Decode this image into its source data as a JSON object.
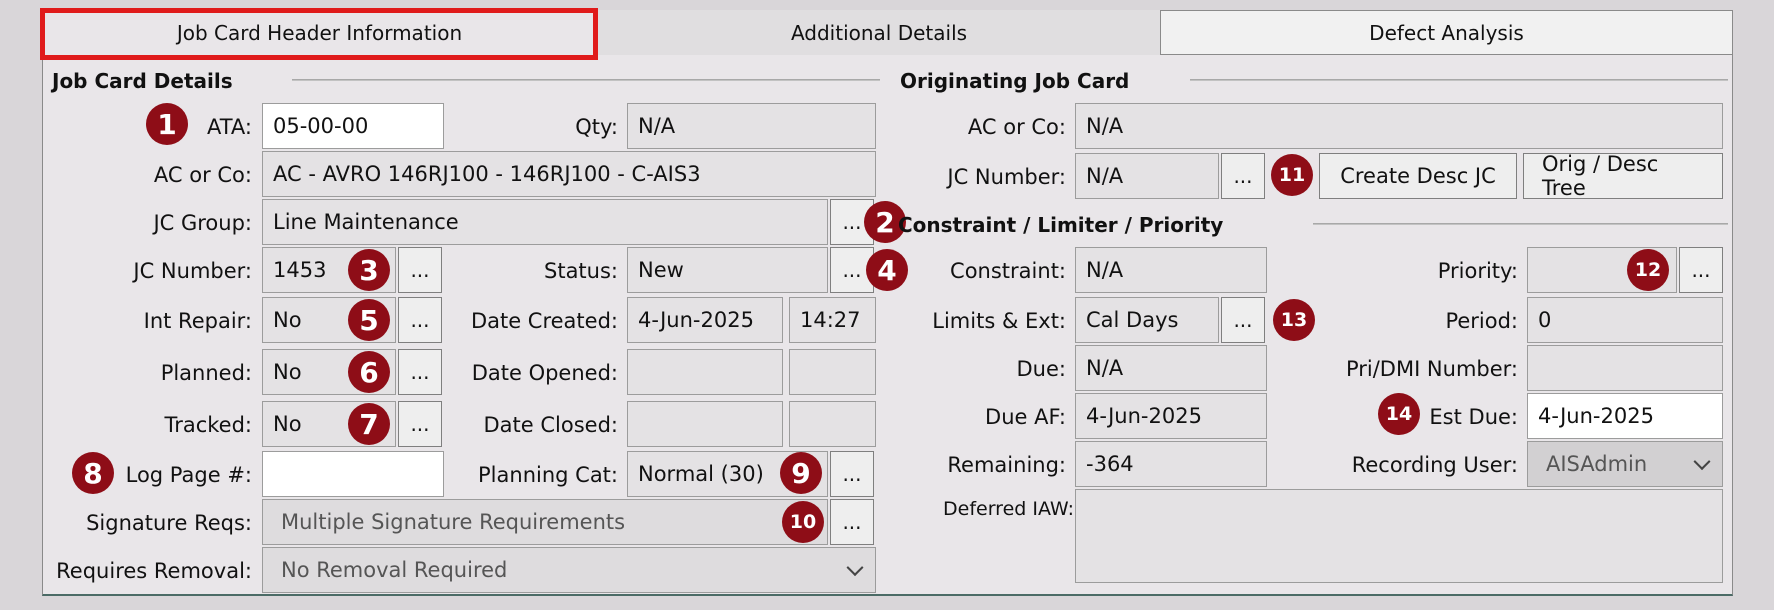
{
  "tabs": [
    {
      "label": "Job Card Header Information"
    },
    {
      "label": "Additional Details"
    },
    {
      "label": "Defect Analysis"
    }
  ],
  "left": {
    "section_title": "Job Card Details",
    "ata_label": "ATA:",
    "ata_value": "05-00-00",
    "qty_label": "Qty:",
    "qty_value": "N/A",
    "ac_label": "AC or Co:",
    "ac_value": "AC - AVRO 146RJ100 - 146RJ100 - C-AIS3",
    "group_label": "JC Group:",
    "group_value": "Line Maintenance",
    "jcnum_label": "JC Number:",
    "jcnum_value": "1453",
    "status_label": "Status:",
    "status_value": "New",
    "intrepair_label": "Int Repair:",
    "intrepair_value": "No",
    "created_label": "Date Created:",
    "created_date": "4-Jun-2025",
    "created_time": "14:27",
    "planned_label": "Planned:",
    "planned_value": "No",
    "opened_label": "Date Opened:",
    "opened_date": "",
    "opened_time": "",
    "tracked_label": "Tracked:",
    "tracked_value": "No",
    "closed_label": "Date Closed:",
    "closed_date": "",
    "closed_time": "",
    "logpage_label": "Log Page #:",
    "logpage_value": "",
    "plancat_label": "Planning Cat:",
    "plancat_value": "Normal (30)",
    "sigreq_label": "Signature Reqs:",
    "sigreq_value": "Multiple Signature Requirements",
    "removal_label": "Requires Removal:",
    "removal_value": "No Removal Required"
  },
  "right": {
    "orig_title": "Originating Job Card",
    "orig_ac_label": "AC or Co:",
    "orig_ac_value": "N/A",
    "orig_jc_label": "JC Number:",
    "orig_jc_value": "N/A",
    "create_desc_label": "Create Desc JC",
    "tree_label": "Orig / Desc Tree",
    "constraint_title": "Constraint / Limiter / Priority",
    "constraint_label": "Constraint:",
    "constraint_value": "N/A",
    "priority_label": "Priority:",
    "priority_value": "",
    "limits_label": "Limits & Ext:",
    "limits_value": "Cal Days",
    "period_label": "Period:",
    "period_value": "0",
    "due_label": "Due:",
    "due_value": "N/A",
    "pridmi_label": "Pri/DMI Number:",
    "pridmi_value": "",
    "dueaf_label": "Due AF:",
    "dueaf_value": "4-Jun-2025",
    "estdue_label": "Est Due:",
    "estdue_value": "4-Jun-2025",
    "remaining_label": "Remaining:",
    "remaining_value": "-364",
    "recuser_label": "Recording User:",
    "recuser_value": "AISAdmin",
    "deferred_label": "Deferred IAW:",
    "deferred_value": ""
  },
  "ellipsis": "...",
  "badges": [
    "1",
    "2",
    "3",
    "4",
    "5",
    "6",
    "7",
    "8",
    "9",
    "10",
    "11",
    "12",
    "13",
    "14"
  ],
  "colors": {
    "badge": "#8e0d17",
    "highlight": "#e01b1b",
    "panel": "#e9e6e9"
  }
}
